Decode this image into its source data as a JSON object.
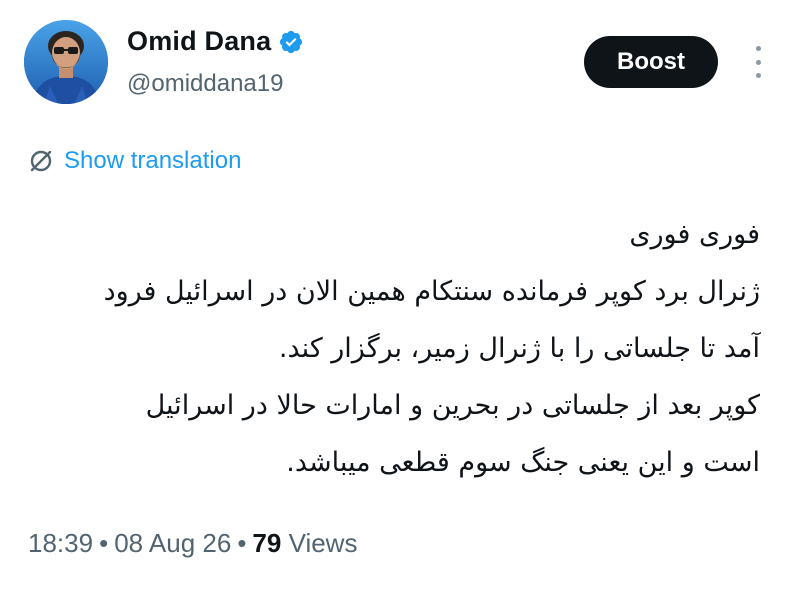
{
  "author": {
    "display_name": "Omid Dana",
    "handle": "@omiddana19",
    "verified_icon": "verified-badge-icon",
    "avatar": "avatar-photo"
  },
  "actions": {
    "boost_label": "Boost",
    "more_icon": "more-vertical-icon"
  },
  "translation": {
    "icon": "translate-icon",
    "label": "Show translation"
  },
  "tweet": {
    "lines": [
      "فوری فوری",
      "ژنرال برد کوپر فرمانده سنتکام همین الان  در اسرائیل فرود",
      "آمد تا جلساتی را با ژنرال زمیر، برگزار کند.",
      "کوپر بعد از جلساتی در بحرین و امارات حالا در اسرائیل",
      "است و این یعنی جنگ سوم قطعی میباشد."
    ]
  },
  "meta": {
    "time": "18:39",
    "separator": "•",
    "date": "08 Aug 26",
    "views_count": "79",
    "views_label": "Views"
  },
  "colors": {
    "text": "#0f1419",
    "secondary": "#536471",
    "link": "#1d9bf0",
    "verified": "#1d9bf0",
    "button_bg": "#0f1419"
  }
}
